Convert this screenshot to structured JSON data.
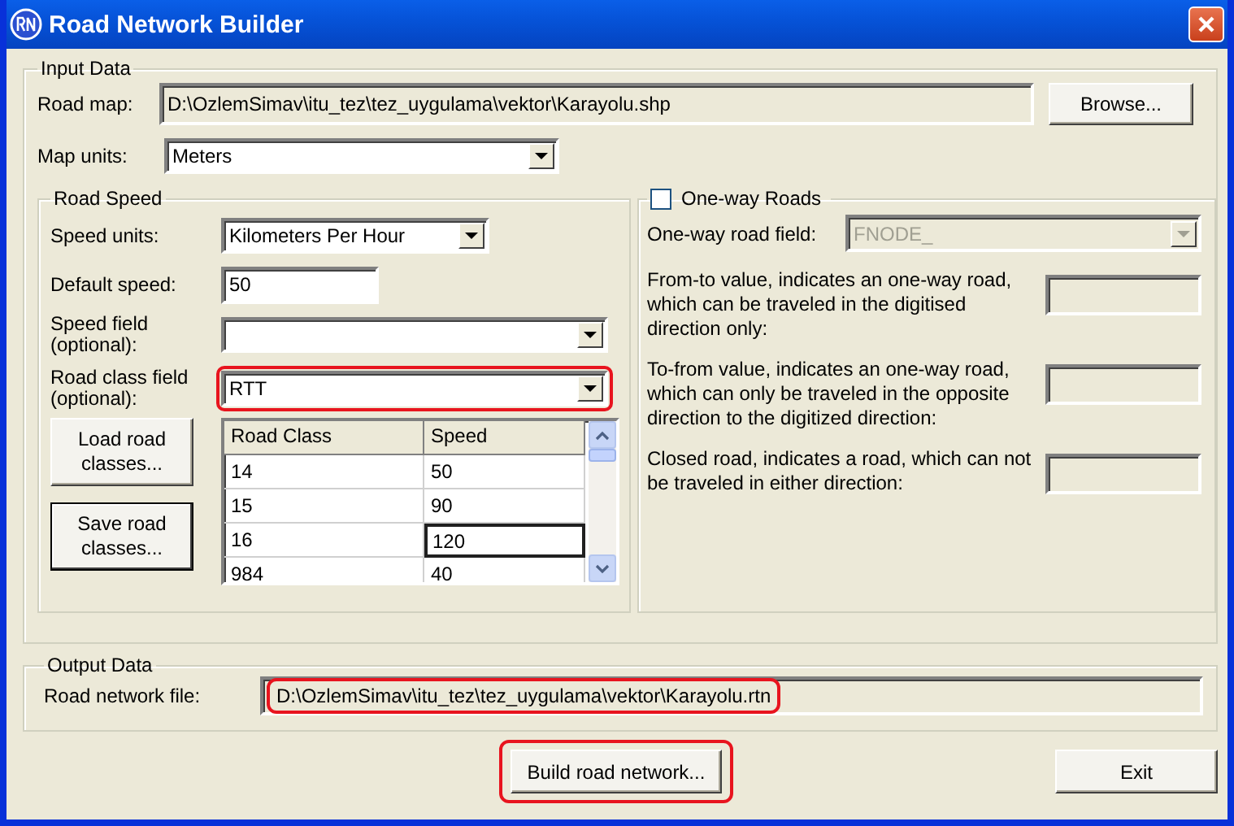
{
  "window": {
    "title": "Road Network Builder"
  },
  "input_data": {
    "title": "Input Data",
    "road_map": {
      "label": "Road map:",
      "value": "D:\\OzlemSimav\\itu_tez\\tez_uygulama\\vektor\\Karayolu.shp"
    },
    "browse_button": "Browse...",
    "map_units": {
      "label": "Map units:",
      "value": "Meters"
    }
  },
  "road_speed": {
    "title": "Road Speed",
    "speed_units": {
      "label": "Speed units:",
      "value": "Kilometers Per Hour"
    },
    "default_speed": {
      "label": "Default speed:",
      "value": "50"
    },
    "speed_field": {
      "label": "Speed field (optional):"
    },
    "road_class_field": {
      "label": "Road class field (optional):",
      "value": "RTT",
      "highlighted": true
    },
    "load_button": {
      "label": "Load road classes...",
      "default": false
    },
    "save_button": {
      "label": "Save road classes...",
      "default": true
    },
    "table": {
      "columns": [
        "Road Class",
        "Speed"
      ],
      "rows": [
        {
          "road_class": "14",
          "speed": "50",
          "editing": false
        },
        {
          "road_class": "15",
          "speed": "90",
          "editing": false
        },
        {
          "road_class": "16",
          "speed": "120",
          "editing": true
        },
        {
          "road_class": "984",
          "speed": "40",
          "editing": false
        }
      ]
    }
  },
  "one_way": {
    "title": "One-way Roads",
    "checked": false,
    "field": {
      "label": "One-way road field:",
      "value": "FNODE_",
      "disabled": true
    },
    "values": [
      {
        "label": "From-to value, indicates an one-way road, which can be traveled in the digitised direction only:"
      },
      {
        "label": "To-from value, indicates an one-way road, which can only be traveled in the opposite direction to the digitized direction:"
      },
      {
        "label": "Closed road, indicates a road, which can not be traveled in either direction:"
      }
    ]
  },
  "output_data": {
    "title": "Output Data",
    "road_network_file": {
      "label": "Road network file:",
      "value": "D:\\OzlemSimav\\itu_tez\\tez_uygulama\\vektor\\Karayolu.rtn",
      "highlighted": true
    }
  },
  "build_button": {
    "label": "Build road network...",
    "highlighted": true
  },
  "exit_button": {
    "label": "Exit"
  }
}
